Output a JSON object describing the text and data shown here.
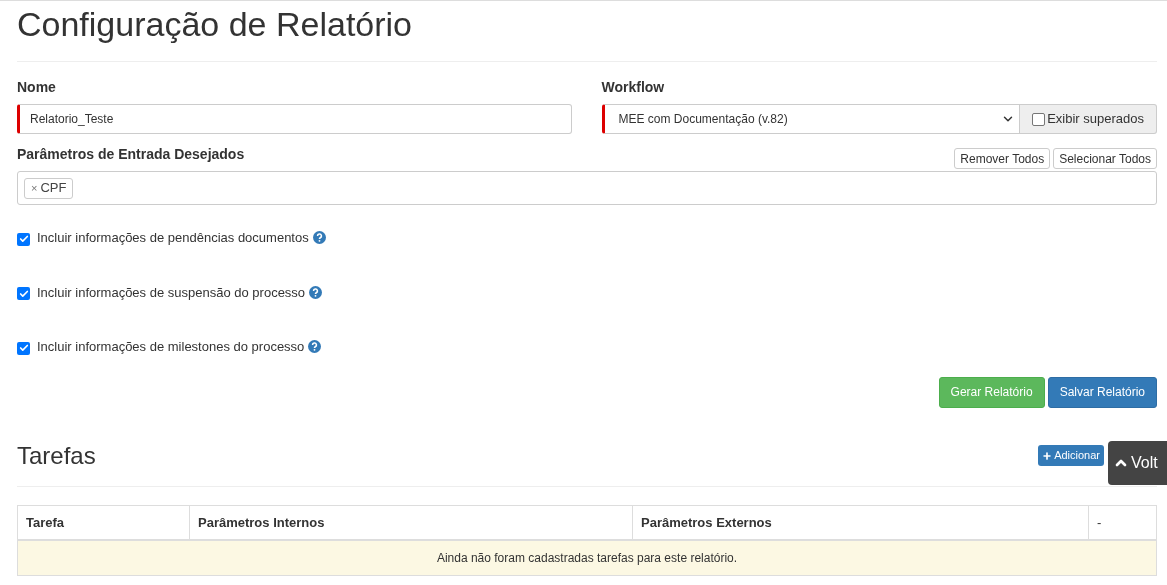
{
  "title": "Configuração de Relatório",
  "nome": {
    "label": "Nome",
    "value": "Relatorio_Teste",
    "required": true
  },
  "workflow": {
    "label": "Workflow",
    "value": "MEE com Documentação (v.82)",
    "required": true,
    "toggle": {
      "label": "Exibir superados",
      "checked": false
    }
  },
  "parametros": {
    "label": "Parâmetros de Entrada Desejados",
    "buttons": [
      "Remover Todos",
      "Selecionar Todos"
    ],
    "tags": [
      {
        "remove": "×",
        "label": "CPF"
      }
    ]
  },
  "options": [
    {
      "label": "Incluir informações de pendências documentos",
      "checked": true
    },
    {
      "label": "Incluir informações de suspensão do processo",
      "checked": true
    },
    {
      "label": "Incluir informações de milestones do processo",
      "checked": true
    }
  ],
  "actions": [
    {
      "label": "Gerar Relatório",
      "kind": "success"
    },
    {
      "label": "Salvar Relatório",
      "kind": "primary"
    }
  ],
  "tarefas": {
    "title": "Tarefas",
    "add_button": "Adicionar",
    "table": {
      "columns": [
        "Tarefa",
        "Parâmetros Internos",
        "Parâmetros Externos",
        "-"
      ],
      "empty": "Ainda não foram cadastradas tarefas para este relatório."
    }
  },
  "back_to_top": {
    "label": "Volt"
  }
}
